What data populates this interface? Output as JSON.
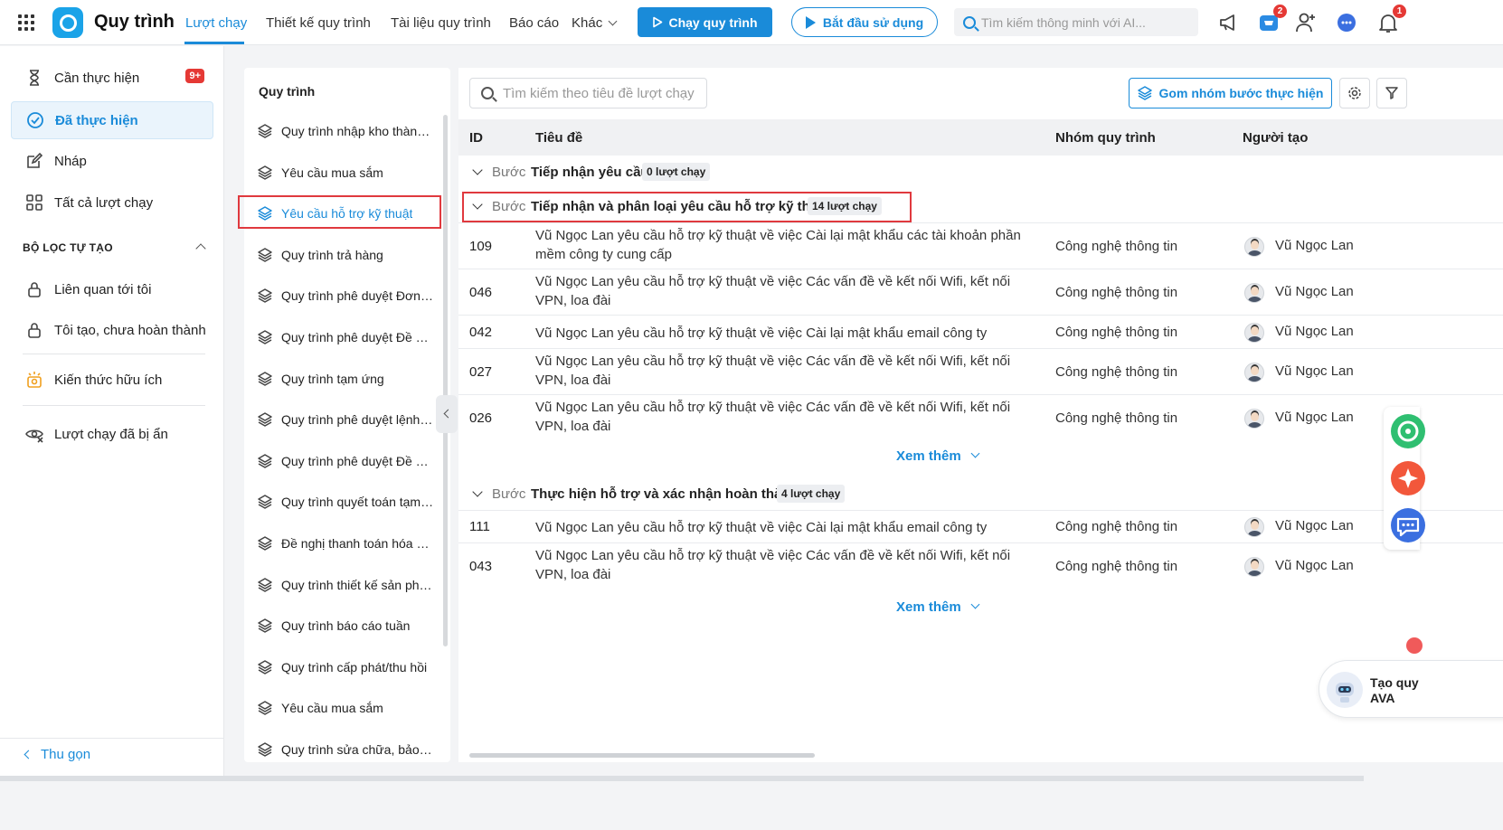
{
  "app": {
    "title": "Quy trình"
  },
  "nav": {
    "items": [
      "Lượt chạy",
      "Thiết kế quy trình",
      "Tài liệu quy trình",
      "Báo cáo",
      "Khác"
    ],
    "run_button": "Chạy quy trình",
    "start_button": "Bắt đầu sử dụng",
    "search_placeholder": "Tìm kiếm thông minh với AI...",
    "cart_badge": "2",
    "bell_badge": "1"
  },
  "sidebar": {
    "items": [
      {
        "label": "Cần thực hiện",
        "badge": "9+"
      },
      {
        "label": "Đã thực hiện"
      },
      {
        "label": "Nháp"
      },
      {
        "label": "Tất cả lượt chạy"
      }
    ],
    "filter_section": "BỘ LỌC TỰ TẠO",
    "filters": [
      "Liên quan tới tôi",
      "Tôi tạo, chưa hoàn thành"
    ],
    "knowledge": "Kiến thức hữu ích",
    "hidden_runs": "Lượt chạy đã bị ẩn",
    "collapse": "Thu gọn"
  },
  "processes": {
    "title": "Quy trình",
    "items": [
      "Quy trình nhập kho thành phẩm",
      "Yêu cầu mua sắm",
      "Yêu cầu hỗ trợ kỹ thuật",
      "Quy trình trả hàng",
      "Quy trình phê duyệt Đơn hàng",
      "Quy trình phê duyệt Đề xuất",
      "Quy trình tạm ứng",
      "Quy trình phê duyệt lệnh sản xuất",
      "Quy trình phê duyệt Đề nghị",
      "Quy trình quyết toán tạm ứng",
      "Đề nghị thanh toán hóa đơn",
      "Quy trình thiết kế sản phẩm",
      "Quy trình báo cáo tuần",
      "Quy trình cấp phát/thu hồi",
      "Yêu cầu mua sắm",
      "Quy trình sửa chữa, bảo dưỡng"
    ],
    "active_index": 2
  },
  "main": {
    "search_placeholder": "Tìm kiếm theo tiêu đề lượt chạy",
    "group_button": "Gom nhóm bước thực hiện",
    "columns": {
      "id": "ID",
      "title": "Tiêu đề",
      "group": "Nhóm quy trình",
      "creator": "Người tạo"
    },
    "step_prefix": "Bước",
    "see_more": "Xem thêm",
    "groups": [
      {
        "name": "Tiếp nhận yêu cầu",
        "count": "0 lượt chạy",
        "rows": []
      },
      {
        "name": "Tiếp nhận và phân loại yêu cầu hỗ trợ kỹ thuật",
        "count": "14 lượt chạy",
        "rows": [
          {
            "id": "109",
            "title": "Vũ Ngọc Lan yêu cầu hỗ trợ kỹ thuật về việc Cài lại mật khẩu các tài khoản phần mềm công ty cung cấp",
            "group": "Công nghệ thông tin",
            "creator": "Vũ Ngọc Lan"
          },
          {
            "id": "046",
            "title": "Vũ Ngọc Lan yêu cầu hỗ trợ kỹ thuật về việc Các vấn đề về kết nối Wifi, kết nối VPN, loa đài",
            "group": "Công nghệ thông tin",
            "creator": "Vũ Ngọc Lan"
          },
          {
            "id": "042",
            "title": "Vũ Ngọc Lan yêu cầu hỗ trợ kỹ thuật về việc Cài lại mật khẩu email công ty",
            "group": "Công nghệ thông tin",
            "creator": "Vũ Ngọc Lan"
          },
          {
            "id": "027",
            "title": "Vũ Ngọc Lan yêu cầu hỗ trợ kỹ thuật về việc Các vấn đề về kết nối Wifi, kết nối VPN, loa đài",
            "group": "Công nghệ thông tin",
            "creator": "Vũ Ngọc Lan"
          },
          {
            "id": "026",
            "title": "Vũ Ngọc Lan yêu cầu hỗ trợ kỹ thuật về việc Các vấn đề về kết nối Wifi, kết nối VPN, loa đài",
            "group": "Công nghệ thông tin",
            "creator": "Vũ Ngọc Lan"
          }
        ]
      },
      {
        "name": "Thực hiện hỗ trợ và xác nhận hoàn thành",
        "count": "4 lượt chạy",
        "rows": [
          {
            "id": "111",
            "title": "Vũ Ngọc Lan yêu cầu hỗ trợ kỹ thuật về việc Cài lại mật khẩu email công ty",
            "group": "Công nghệ thông tin",
            "creator": "Vũ Ngọc Lan"
          },
          {
            "id": "043",
            "title": "Vũ Ngọc Lan yêu cầu hỗ trợ kỹ thuật về việc Các vấn đề về kết nối Wifi, kết nối VPN, loa đài",
            "group": "Công nghệ thông tin",
            "creator": "Vũ Ngọc Lan"
          }
        ]
      }
    ]
  },
  "assistant": {
    "line1": "Tạo quy",
    "line2": "AVA"
  },
  "colors": {
    "primary": "#1a8bd9",
    "badge_red": "#e53935",
    "highlight_box": "#e0393e"
  }
}
